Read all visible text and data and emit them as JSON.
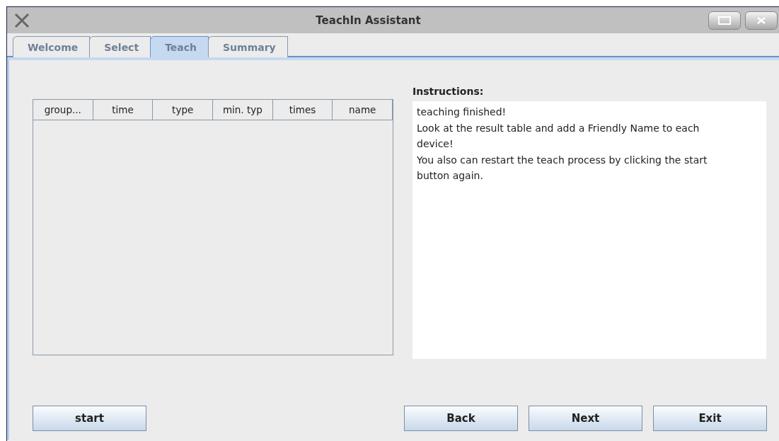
{
  "window": {
    "title": "TeachIn Assistant"
  },
  "tabs": [
    {
      "label": "Welcome",
      "selected": false
    },
    {
      "label": "Select",
      "selected": false
    },
    {
      "label": "Teach",
      "selected": true
    },
    {
      "label": "Summary",
      "selected": false
    }
  ],
  "table": {
    "columns": [
      "group...",
      "time",
      "type",
      "min. typ",
      "times",
      "name"
    ]
  },
  "instructions": {
    "label": "Instructions:",
    "lines": [
      "teaching finished!",
      "Look at the result table and add a Friendly Name to each device!",
      "You also can restart the teach process by clicking the start button again."
    ]
  },
  "buttons": {
    "left": [
      "start"
    ],
    "right": [
      "Back",
      "Next",
      "Exit"
    ]
  }
}
